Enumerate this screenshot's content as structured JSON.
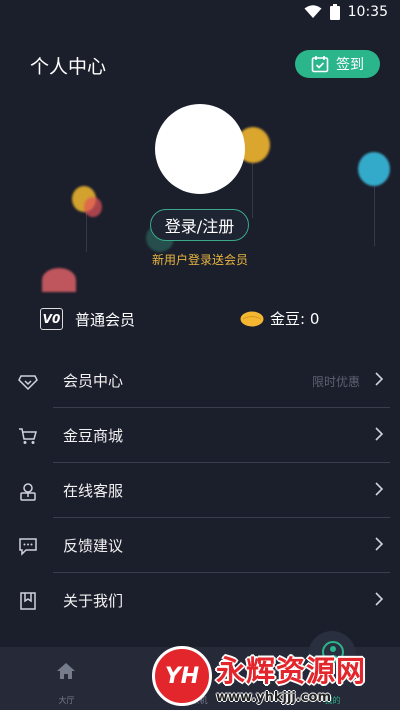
{
  "status_bar": {
    "time": "10:35"
  },
  "header": {
    "title": "个人中心",
    "signin_label": "签到"
  },
  "profile": {
    "login_label": "登录/注册",
    "promo_text": "新用户登录送会员"
  },
  "membership": {
    "vip_badge": "V0",
    "level_label": "普通会员",
    "coins_label": "金豆: 0"
  },
  "menu": [
    {
      "label": "会员中心",
      "tag": "限时优惠",
      "icon": "diamond-icon"
    },
    {
      "label": "金豆商城",
      "tag": "",
      "icon": "cart-icon"
    },
    {
      "label": "在线客服",
      "tag": "",
      "icon": "customer-service-icon"
    },
    {
      "label": "反馈建议",
      "tag": "",
      "icon": "chat-icon"
    },
    {
      "label": "关于我们",
      "tag": "",
      "icon": "bookmark-icon"
    }
  ],
  "bottom_nav": [
    {
      "label": "大厅",
      "icon": "home-icon"
    },
    {
      "label": "联机",
      "icon": "connect-icon"
    },
    {
      "label": "我的",
      "icon": "profile-icon"
    }
  ],
  "watermark": {
    "logo": "YH",
    "title": "永辉资源网",
    "url": "www.yhkjjj.com"
  },
  "colors": {
    "background": "#1b1e2b",
    "accent": "#2bb58a",
    "promo": "#e8b640",
    "coin": "#f5b731"
  }
}
